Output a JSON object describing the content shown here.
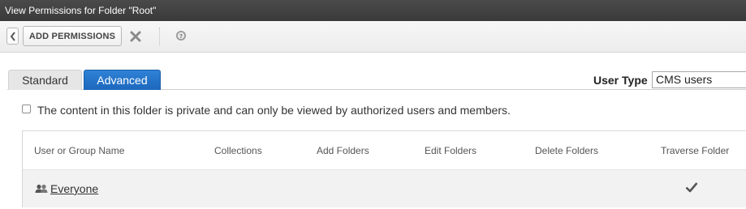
{
  "window": {
    "title": "View Permissions for Folder \"Root\""
  },
  "toolbar": {
    "add_permissions_label": "ADD PERMISSIONS",
    "back_icon": "chevron-left-icon",
    "close_icon": "close-icon",
    "help_icon": "help-icon"
  },
  "tabs": [
    {
      "label": "Standard",
      "active": false
    },
    {
      "label": "Advanced",
      "active": true
    }
  ],
  "user_type": {
    "label": "User Type",
    "value": "CMS users"
  },
  "private_option": {
    "label": "The content in this folder is private and can only be viewed by authorized users and members.",
    "checked": false
  },
  "table": {
    "columns": [
      "User or Group Name",
      "Collections",
      "Add Folders",
      "Edit Folders",
      "Delete Folders",
      "Traverse Folder"
    ],
    "rows": [
      {
        "name": "Everyone",
        "icon": "group-icon",
        "traverse_folder": true
      }
    ]
  },
  "colors": {
    "accent": "#1f6fc5",
    "titlebar": "#3f3f3f"
  }
}
